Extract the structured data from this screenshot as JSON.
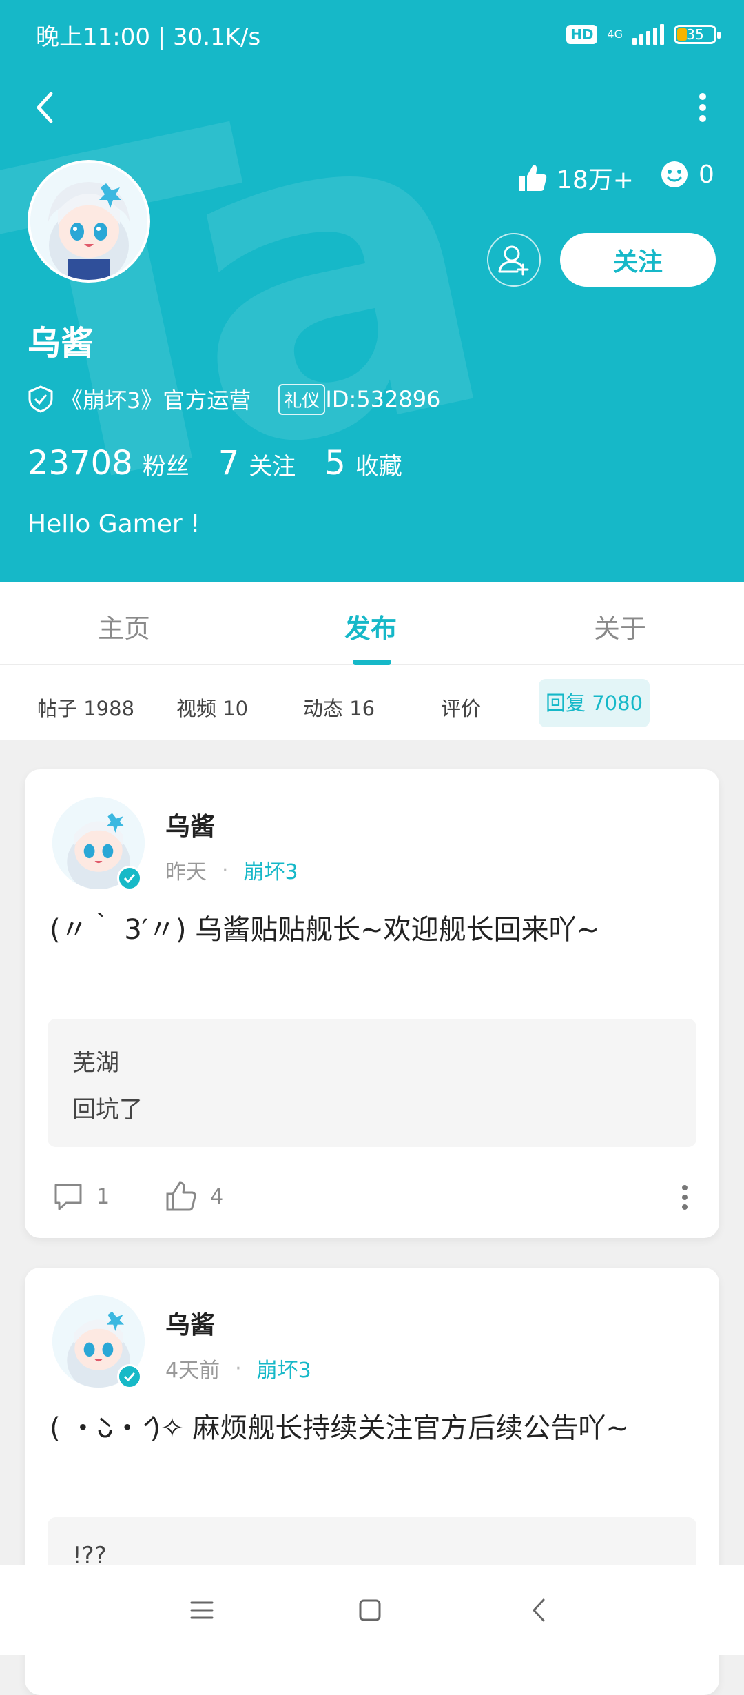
{
  "status_bar": {
    "time_speed": "晚上11:00 | 30.1K/s",
    "hd": "HD",
    "network": "4G",
    "battery": "35"
  },
  "header": {
    "likes": "18万+",
    "emoji_count": "0",
    "follow_label": "关注",
    "name": "乌酱",
    "official_label": "《崩坏3》官方运营",
    "etiquette_badge": "礼仪",
    "user_id": "ID:532896",
    "stats": {
      "fans_count": "23708",
      "fans_label": "粉丝",
      "following_count": "7",
      "following_label": "关注",
      "collect_count": "5",
      "collect_label": "收藏"
    },
    "bio": "Hello Gamer !",
    "accent_color": "#16b8c8"
  },
  "tabs": {
    "home": "主页",
    "publish": "发布",
    "about": "关于"
  },
  "subtabs": {
    "posts": "帖子 1988",
    "videos": "视频 10",
    "dynamic": "动态 16",
    "review": "评价",
    "reply": "回复 7080"
  },
  "cards": [
    {
      "author": "乌酱",
      "time": "昨天",
      "game": "崩坏3",
      "text": "(〃｀ 3′〃) 乌酱贴贴舰长~欢迎舰长回来吖~",
      "quote_user": "芜湖",
      "quote_text": "回坑了",
      "comments": "1",
      "likes": "4"
    },
    {
      "author": "乌酱",
      "time": "4天前",
      "game": "崩坏3",
      "text": "( ・̀ᴗ・́ )✧ 麻烦舰长持续关注官方后续公告吖~",
      "quote_user": "!??"
    }
  ]
}
